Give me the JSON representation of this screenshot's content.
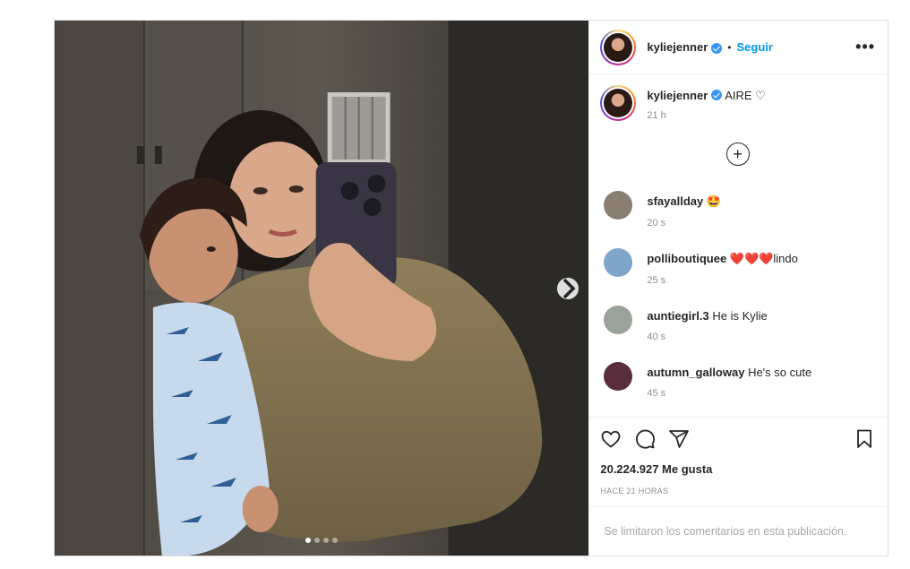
{
  "post": {
    "username": "kyliejenner",
    "follow_label": "Seguir",
    "separator": "•",
    "more_label": "•••",
    "caption": "AIRE ♡",
    "caption_time": "21 h",
    "load_more_label": "+",
    "comments": [
      {
        "user": "sfayallday",
        "text": "🤩",
        "time": "20 s",
        "avatar_color": "#8a7d72"
      },
      {
        "user": "polliboutiquee",
        "text": "❤️❤️❤️lindo",
        "time": "25 s",
        "avatar_color": "#7fa6c9"
      },
      {
        "user": "auntiegirl.3",
        "text": "He is Kylie",
        "time": "40 s",
        "avatar_color": "#9aa39b"
      },
      {
        "user": "autumn_galloway",
        "text": "He's so cute",
        "time": "45 s",
        "avatar_color": "#5a2d3d"
      }
    ],
    "likes": "20.224.927 Me gusta",
    "posted_ago": "HACE 21 HORAS",
    "comments_limited": "Se limitaron los comentarios en esta publicación.",
    "carousel_count": 4,
    "carousel_active": 1
  },
  "icons": {
    "verified": "verified-badge-icon",
    "like": "heart-icon",
    "comment": "comment-icon",
    "share": "share-icon",
    "save": "bookmark-icon",
    "next": "chevron-right-icon",
    "add": "plus-circle-icon"
  },
  "colors": {
    "accent": "#0095f6",
    "muted": "#8e8e8e",
    "border": "#dbdbdb"
  }
}
